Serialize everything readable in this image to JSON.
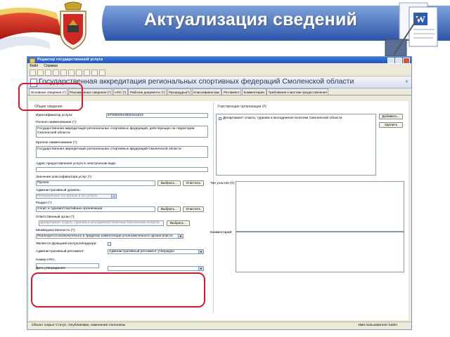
{
  "slide": {
    "title": "Актуализация сведений"
  },
  "window": {
    "title": "Редактор государственной услуги",
    "menu": [
      "Файл",
      "Справка"
    ],
    "doc_title": "Государственная аккредитация региональных спортивных федераций Смоленской области"
  },
  "tabs": [
    "Основные сведения (*)",
    "Расширенные сведения (*)",
    "НПА (*)",
    "Рабочие документы (*)",
    "Процедуры(*)",
    "Классификаторы",
    "Регламент",
    "Комментарии",
    "Требования к местам предоставления"
  ],
  "left": {
    "section_title": "Общие сведения",
    "service_id_label": "Идентификатор услуги:",
    "service_id_value": "6700000010000161619",
    "full_name_label": "Полное наименование (*):",
    "full_name_value": "Государственная аккредитация региональных спортивных федераций, действующих на территории Смоленской области",
    "short_name_label": "Краткое наименование (*):",
    "short_name_value": "Государственная аккредитация региональных спортивных федераций Смоленской области",
    "address_label": "Адрес предоставления услуги в электронном виде:",
    "classifier_label": "Значение классификатора услуг (*):",
    "classifier_value": "Прочее",
    "admin_level_label": "Административный уровень:",
    "admin_level_value": "Региональные гос.органы и гос.услуги",
    "section_label": "Раздел (*):",
    "section_value": "Спорт и туризм\\Спортивные организации",
    "responsible_label": "Ответственный орган (*):",
    "responsible_value": "Департамент спорта, туризма и молодежной политики Смоленской области",
    "interdept_label": "Межведомственность (*):",
    "interdept_value": "Реализуется исключительно в пределах компетенции уполномоченного органа власти",
    "ext_control_label": "Является функцией контроля/надзора:",
    "reglament_label": "Административный регламент:",
    "reglament_value": "Административный регламент утвержден",
    "npa_number_label": "Номер НПА:",
    "approval_date_label": "Дата утверждения:"
  },
  "buttons": {
    "select": "Выбрать...",
    "clear": "Очистить",
    "add": "Добавить...",
    "delete": "Удалить"
  },
  "right": {
    "participants_title": "Участвующие организации (#)",
    "participant_1": "Департамент спорта, туризма и молодежной политики Смоленской области",
    "participation_type_label": "Тип участия (#):",
    "comment_label": "Комментарий:"
  },
  "status": {
    "left": "Объект открыт  Статус: Опубликован, изменения отклонены",
    "right": "Имя пользователя: katrin"
  },
  "colors": {
    "ribbon_blue": "#3a64b8",
    "ribbon_red": "#c8201c",
    "annotation_red": "#d8192a",
    "titlebar_blue": "#2a62cc"
  }
}
